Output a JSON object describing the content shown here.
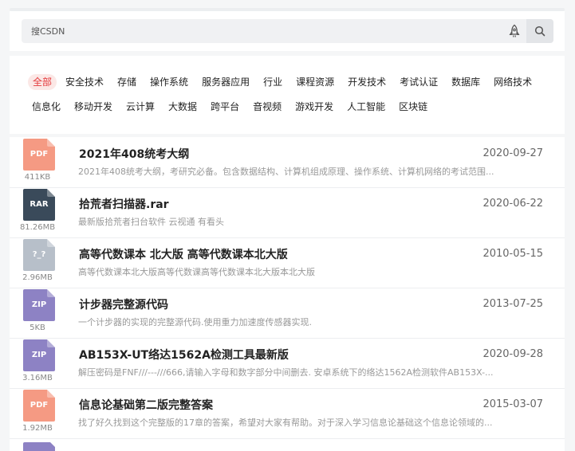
{
  "search": {
    "placeholder": "搜CSDN"
  },
  "icons": {
    "rocket": "rocket-icon",
    "search": "search-icon"
  },
  "colors": {
    "pdf": "#f59a83",
    "rar": "#3a4a5a",
    "unknown": "#b7bfc9",
    "zip": "#8d82c4",
    "active_bg": "#fbe8e6",
    "active_text": "#e4393c"
  },
  "categories": {
    "row1": [
      "全部",
      "安全技术",
      "存储",
      "操作系统",
      "服务器应用",
      "行业",
      "课程资源",
      "开发技术",
      "考试认证",
      "数据库",
      "网络技术"
    ],
    "row2": [
      "信息化",
      "移动开发",
      "云计算",
      "大数据",
      "跨平台",
      "音视频",
      "游戏开发",
      "人工智能",
      "区块链"
    ],
    "active": "全部"
  },
  "items": [
    {
      "type": "PDF",
      "size": "411KB",
      "title": "2021年408统考大纲",
      "date": "2020-09-27",
      "desc": "2021年408统考大纲，考研究必备。包含数据结构、计算机组成原理、操作系统、计算机网络的考试范围..."
    },
    {
      "type": "RAR",
      "size": "81.26MB",
      "title": "拾荒者扫描器.rar",
      "date": "2020-06-22",
      "desc": "最新版拾荒者扫台软件 云视通 有看头"
    },
    {
      "type": "?_?",
      "size": "2.96MB",
      "title": "高等代数课本 北大版 高等代数课本北大版",
      "date": "2010-05-15",
      "desc": "高等代数课本北大版高等代数课高等代数课本北大版本北大版"
    },
    {
      "type": "ZIP",
      "size": "5KB",
      "title": "计步器完整源代码",
      "date": "2013-07-25",
      "desc": "一个计步器的实现的完整源代码.使用重力加速度传感器实现."
    },
    {
      "type": "ZIP",
      "size": "3.16MB",
      "title": "AB153X-UT络达1562A检测工具最新版",
      "date": "2020-09-28",
      "desc": "解压密码是FNF///---///666,请输入字母和数字部分中间删去. 安卓系统下的络达1562A检测软件AB153X-..."
    },
    {
      "type": "PDF",
      "size": "1.92MB",
      "title": "信息论基础第二版完整答案",
      "date": "2015-03-07",
      "desc": "找了好久找到这个完整版的17章的答案，希望对大家有帮助。对于深入学习信息论基础这个信息论领域的..."
    }
  ]
}
